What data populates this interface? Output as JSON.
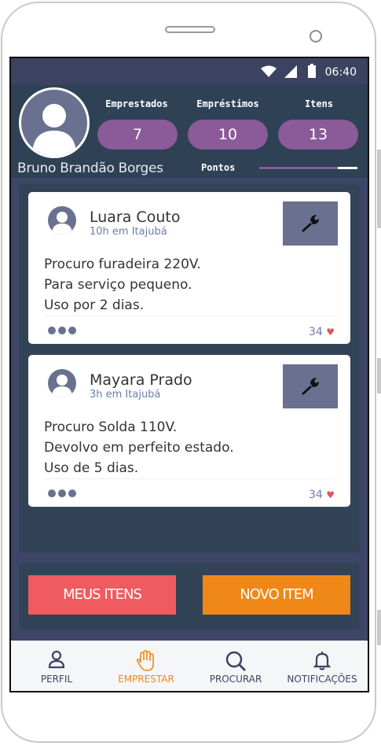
{
  "status": {
    "time": "06:40"
  },
  "profile": {
    "name": "Bruno Brandão Borges",
    "stats": [
      {
        "label": "Emprestados",
        "value": "7"
      },
      {
        "label": "Empréstimos",
        "value": "10"
      },
      {
        "label": "Itens",
        "value": "13"
      }
    ],
    "points_label": "Pontos",
    "points_progress": 0.8
  },
  "posts": [
    {
      "author": "Luara Couto",
      "meta": "10h em Itajubá",
      "lines": [
        "Procuro furadeira 220V.",
        "Para serviço pequeno.",
        "Uso por 2 dias."
      ],
      "likes": "34",
      "tool_icon": "wrench-icon"
    },
    {
      "author": "Mayara Prado",
      "meta": "3h em Itajubá",
      "lines": [
        "Procuro Solda 110V.",
        "Devolvo em perfeito estado.",
        "Uso de 5 dias."
      ],
      "likes": "34",
      "tool_icon": "wrench-icon"
    }
  ],
  "actions": {
    "my_items": "MEUS ITENS",
    "new_item": "NOVO ITEM"
  },
  "tabs": [
    {
      "label": "PERFIL",
      "icon": "user-icon"
    },
    {
      "label": "EMPRESTAR",
      "icon": "hand-icon",
      "active": true
    },
    {
      "label": "PROCURAR",
      "icon": "search-icon"
    },
    {
      "label": "NOTIFICAÇÕES",
      "icon": "bell-icon"
    }
  ],
  "colors": {
    "header": "#2e4155",
    "accent_purple": "#8b5a99",
    "button_red": "#ef5b5f",
    "button_orange": "#f08818",
    "icon_slate": "#6a7090"
  }
}
